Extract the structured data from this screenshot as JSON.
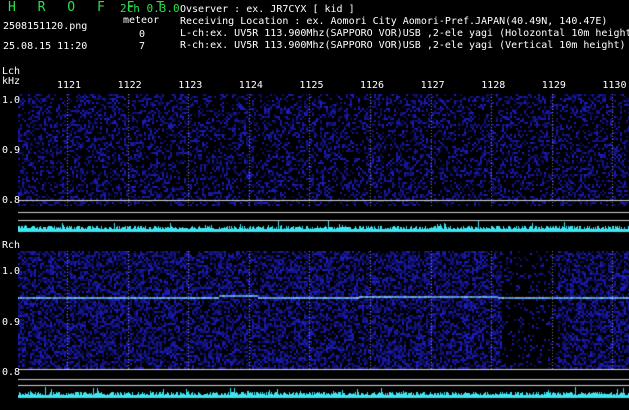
{
  "header": {
    "logo": "H R O F F T",
    "version": "2ch 0.3.0",
    "filename": "2508151120.png",
    "meteor_label": "meteor",
    "lch_count": "0",
    "rch_count": "7",
    "datetime": "25.08.15 11:20",
    "observer": "Ovserver           : ex. JR7CYX [ kid ]",
    "location": "Receiving Location : ex. Aomori City Aomori-Pref.JAPAN(40.49N, 140.47E)",
    "lch_info": "L-ch:ex. UV5R 113.900Mhz(SAPPORO VOR)USB ,2-ele yagi (Holozontal 10m height",
    "rch_info": "R-ch:ex. UV5R 113.900Mhz(SAPPORO VOR)USB ,2-ele yagi (Vertical 10m height)"
  },
  "axis": {
    "lch_label": "Lch",
    "unit": "kHz",
    "rch_label": "Rch",
    "time_ticks": [
      "1121",
      "1122",
      "1123",
      "1124",
      "1125",
      "1126",
      "1127",
      "1128",
      "1129",
      "1130"
    ],
    "lch_freq_ticks": [
      "1.0",
      "0.9",
      "0.8"
    ],
    "rch_freq_ticks": [
      "1.0",
      "0.9",
      "0.8"
    ]
  },
  "colors": {
    "logo": "#27e34a",
    "background": "#000000",
    "noise": "#1a1aa0",
    "signal": "#5ab4ff",
    "level": "#3fe6f0"
  }
}
